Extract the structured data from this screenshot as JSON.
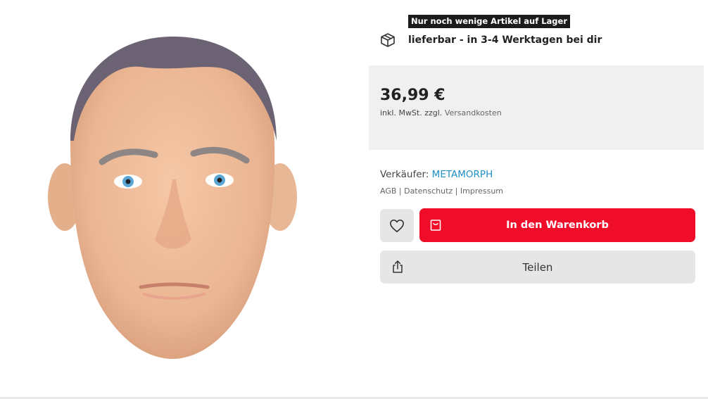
{
  "product": {
    "image_alt": "latex mask",
    "stock_badge": "Nur noch wenige Artikel auf Lager",
    "delivery_text": "lieferbar - in 3-4 Werktagen bei dir",
    "price": "36,99 €",
    "tax_prefix": "inkl. MwSt. zzgl.",
    "shipping_link": "Versandkosten"
  },
  "seller": {
    "label": "Verkäufer:",
    "name": "METAMORPH",
    "legal_links": "AGB | Datenschutz | Impressum"
  },
  "actions": {
    "add_to_cart": "In den Warenkorb",
    "share": "Teilen"
  },
  "icons": {
    "delivery": "package-icon",
    "wishlist": "heart-icon",
    "cart": "shopping-bag-icon",
    "share": "share-icon"
  },
  "colors": {
    "accent_red": "#ef0d2a",
    "seller_link": "#1f8fc7",
    "price_box_bg": "#f0f0f0",
    "button_bg": "#e6e6e6"
  }
}
